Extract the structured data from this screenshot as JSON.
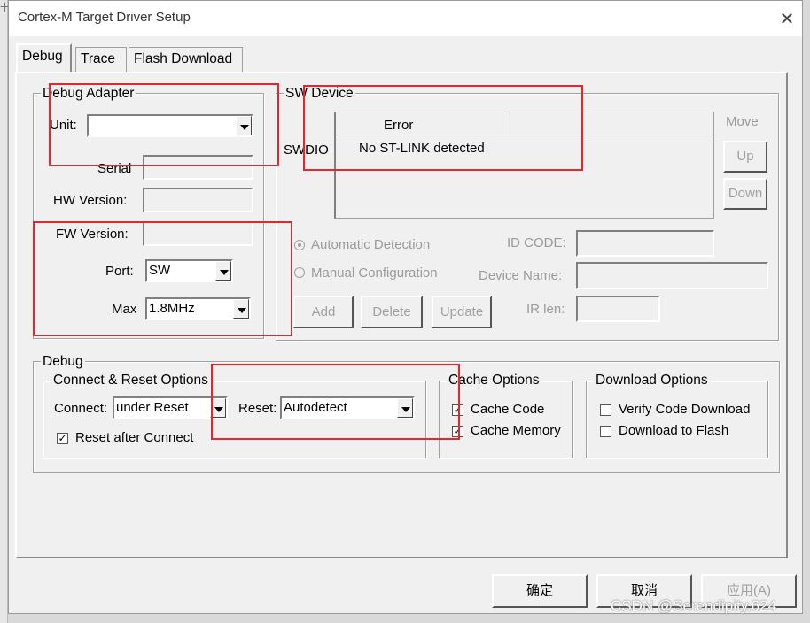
{
  "window": {
    "title": "Cortex-M Target Driver Setup",
    "left_edge_mark": "十"
  },
  "tabs": [
    {
      "label": "Debug"
    },
    {
      "label": "Trace"
    },
    {
      "label": "Flash Download"
    }
  ],
  "debug_adapter": {
    "group_label": "Debug Adapter",
    "unit_label": "Unit:",
    "unit_value": "",
    "serial_label": "Serial",
    "hw_version_label": "HW Version:",
    "fw_version_label": "FW Version:",
    "port_label": "Port:",
    "port_value": "SW",
    "max_label": "Max",
    "max_value": "1.8MHz"
  },
  "sw_device": {
    "group_label": "SW Device",
    "swdio_label": "SWDIO",
    "table_header": "Error",
    "table_row": "No ST-LINK detected",
    "move_label": "Move",
    "up_label": "Up",
    "down_label": "Down",
    "auto_detect": "Automatic Detection",
    "manual_config": "Manual Configuration",
    "id_code_label": "ID CODE:",
    "device_name_label": "Device Name:",
    "ir_len_label": "IR len:",
    "add_label": "Add",
    "delete_label": "Delete",
    "update_label": "Update"
  },
  "debug": {
    "group_label": "Debug",
    "connect_reset_label": "Connect & Reset Options",
    "connect_label": "Connect:",
    "connect_value": "under Reset",
    "reset_label": "Reset:",
    "reset_value": "Autodetect",
    "reset_after_connect": "Reset after Connect",
    "cache_options_label": "Cache Options",
    "cache_code": "Cache Code",
    "cache_memory": "Cache Memory",
    "download_options_label": "Download Options",
    "verify_code_download": "Verify Code Download",
    "download_to_flash": "Download to Flash",
    "check_mark": "✓"
  },
  "footer": {
    "ok": "确定",
    "cancel": "取消",
    "apply": "应用(A)"
  },
  "watermark": "CSDN @Serendipity.624",
  "colors": {
    "highlight": "#e0282e"
  }
}
